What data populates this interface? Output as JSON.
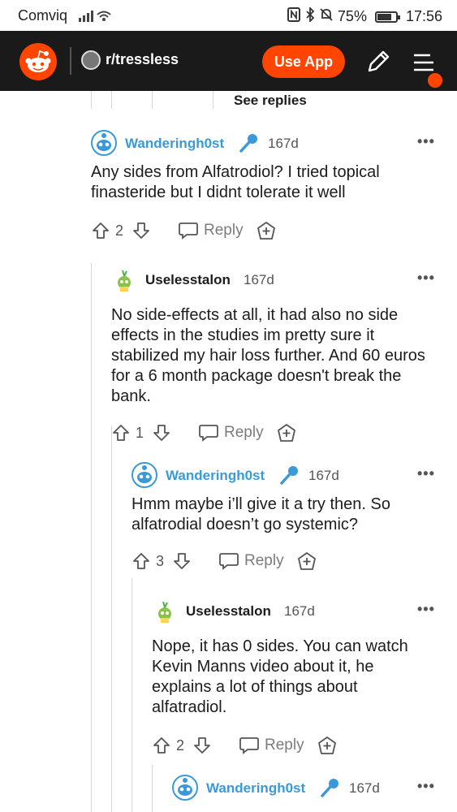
{
  "status": {
    "carrier": "Comviq",
    "battery": "75%",
    "battery_level": 0.75,
    "time": "17:56"
  },
  "header": {
    "subreddit": "r/tressless",
    "use_app": "Use App"
  },
  "thread": {
    "see_replies": "See replies",
    "comments": [
      {
        "author": "Wanderingh0st",
        "age": "167d",
        "body": "Any sides from Alfatrodiol? I tried topical finasteride but I didnt tolerate it well",
        "votes": "2",
        "reply": "Reply"
      },
      {
        "author": "Uselesstalon",
        "age": "167d",
        "body": "No side-effects at all, it had also no side effects in the studies im pretty sure it stabilized my hair loss further. And 60 euros for a 6 month package doesn't break the bank.",
        "votes": "1",
        "reply": "Reply"
      },
      {
        "author": "Wanderingh0st",
        "age": "167d",
        "body": "Hmm maybe i’ll give it a try then. So alfatrodial doesn’t go systemic?",
        "votes": "3",
        "reply": "Reply"
      },
      {
        "author": "Uselesstalon",
        "age": "167d",
        "body": "Nope, it has 0 sides. You can watch Kevin Manns video about it, he explains a lot of things about alfatradiol.",
        "votes": "2",
        "reply": "Reply"
      },
      {
        "author": "Wanderingh0st",
        "age": "167d",
        "body": "",
        "votes": "",
        "reply": ""
      }
    ]
  },
  "icons": {
    "more": "more-options-icon",
    "upvote": "upvote-icon",
    "downvote": "downvote-icon",
    "reply": "reply-bubble-icon",
    "award": "award-icon",
    "mic": "microphone-icon"
  }
}
